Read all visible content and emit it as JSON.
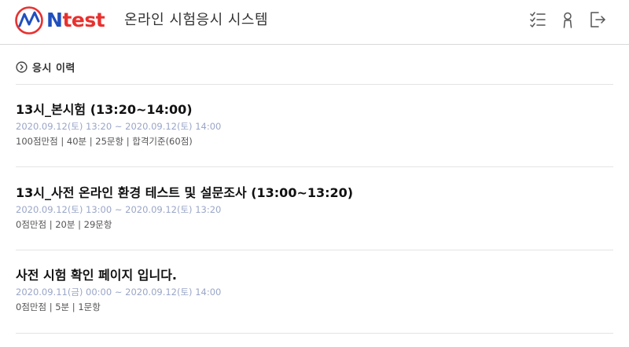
{
  "header": {
    "logo_text_n": "N",
    "logo_text_rest": "test",
    "app_title": "온라인 시험응시 시스템",
    "icons": [
      "checklist-icon",
      "user-icon",
      "logout-icon"
    ]
  },
  "section": {
    "icon": "chevron-circle-right-icon",
    "title": "응시 이력"
  },
  "exams": [
    {
      "title": "13시_본시험 (13:20~14:00)",
      "period": "2020.09.12(토) 13:20 ~ 2020.09.12(토) 14:00",
      "info": "100점만점 | 40분 | 25문항 | 합격기준(60점)"
    },
    {
      "title": "13시_사전 온라인 환경 테스트 및 설문조사 (13:00~13:20)",
      "period": "2020.09.12(토) 13:00 ~ 2020.09.12(토) 13:20",
      "info": "0점만점 | 20분 | 29문항"
    },
    {
      "title": "사전 시험 확인 페이지 입니다.",
      "period": "2020.09.11(금) 00:00 ~ 2020.09.12(토) 14:00",
      "info": "0점만점 | 5분 | 1문항"
    }
  ],
  "colors": {
    "logo_blue": "#1f4fbf",
    "logo_red": "#e8312f",
    "period_text": "#9aa6c8",
    "divider": "#e4e4e4"
  }
}
